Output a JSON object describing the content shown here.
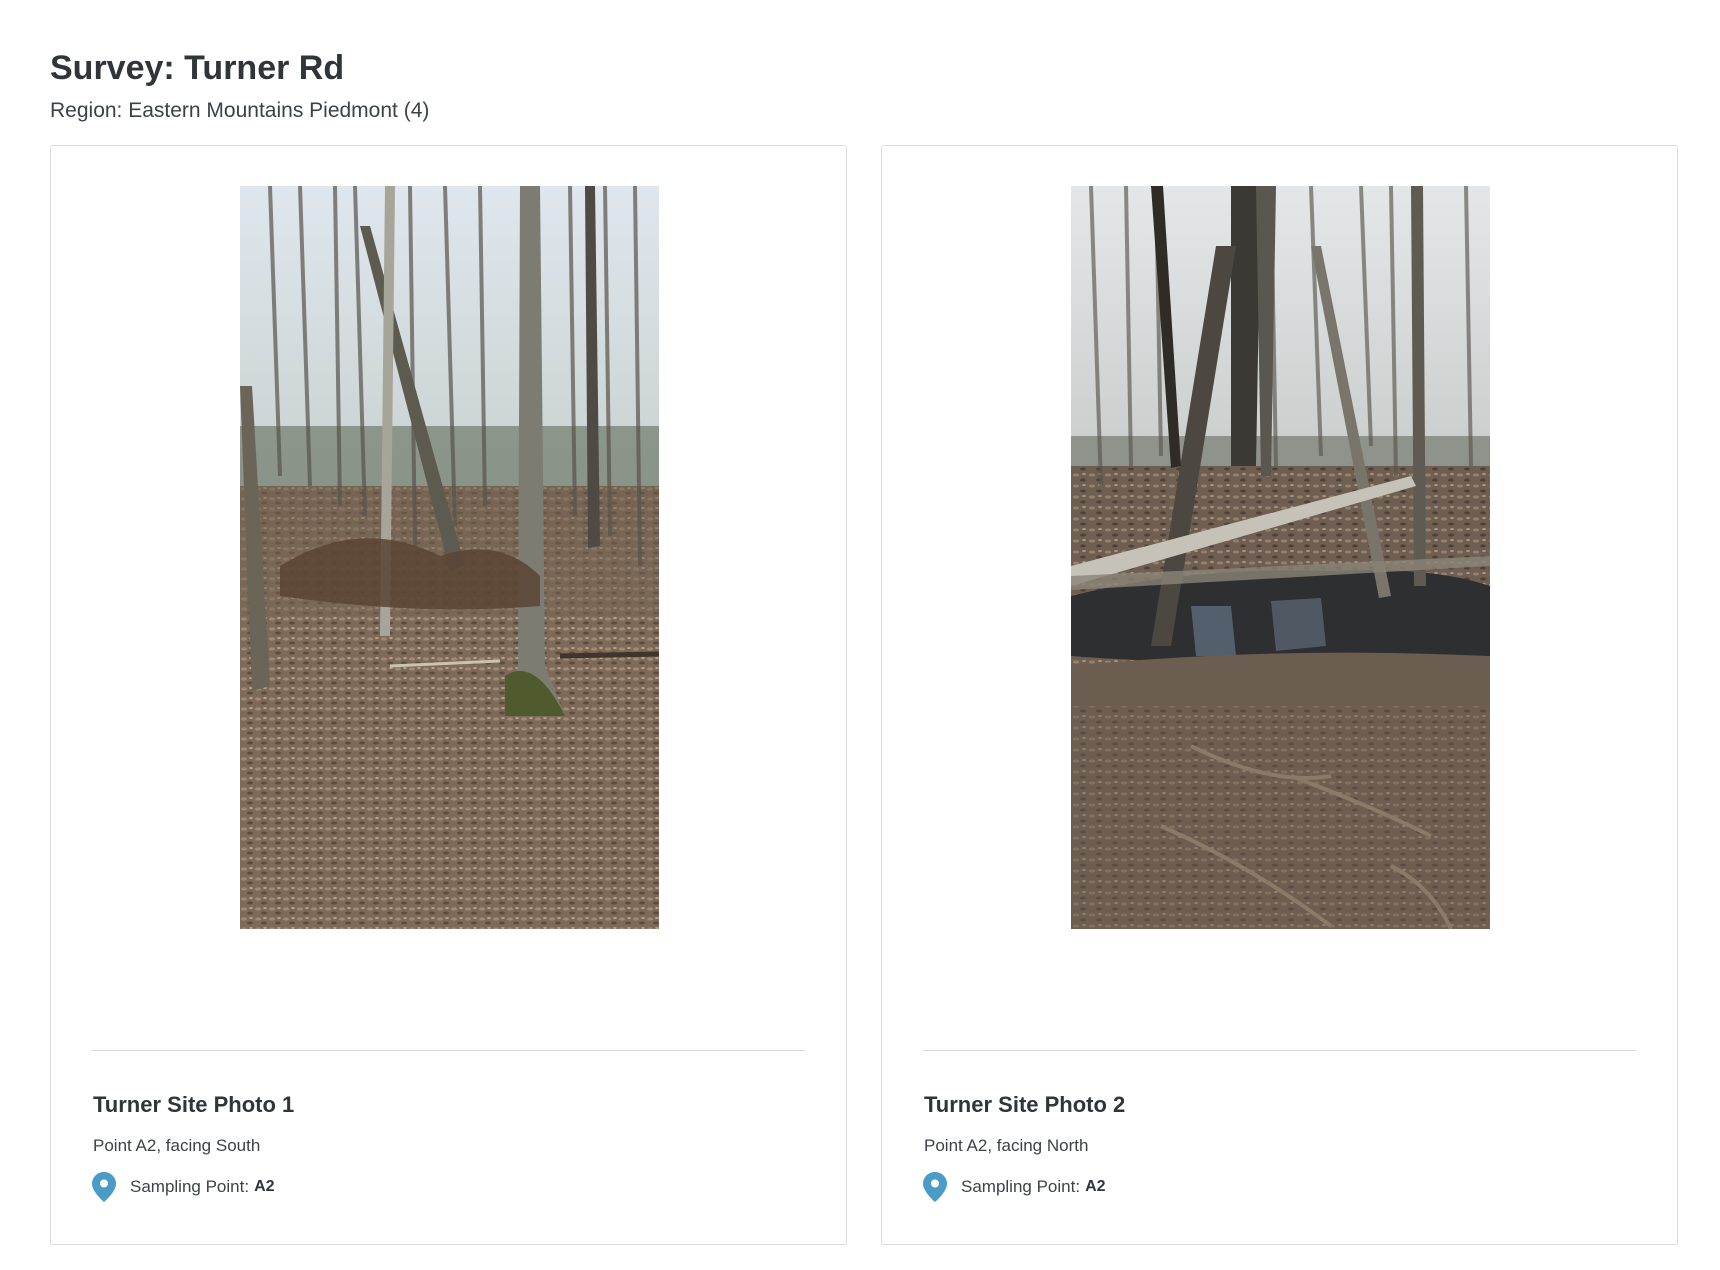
{
  "survey": {
    "title": "Survey: Turner Rd",
    "region": "Region: Eastern Mountains Piedmont (4)"
  },
  "photos": [
    {
      "title": "Turner Site Photo 1",
      "description": "Point A2, facing South",
      "sampling_label": "Sampling Point:",
      "sampling_value": "A2",
      "image_icon": "forest-photo-icon"
    },
    {
      "title": "Turner Site Photo 2",
      "description": "Point A2, facing North",
      "sampling_label": "Sampling Point:",
      "sampling_value": "A2",
      "image_icon": "creek-photo-icon"
    }
  ],
  "colors": {
    "pin": "#4a9cc7",
    "border": "#dadcdd",
    "text": "#333a3f"
  }
}
